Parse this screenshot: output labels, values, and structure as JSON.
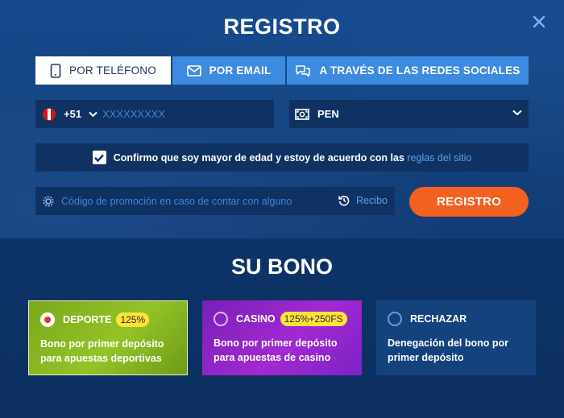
{
  "modal": {
    "title": "REGISTRO"
  },
  "tabs": [
    {
      "label": "POR TELÉFONO",
      "icon": "phone-icon",
      "active": true
    },
    {
      "label": "POR EMAIL",
      "icon": "envelope-icon",
      "active": false
    },
    {
      "label": "A TRAVÉS DE LAS REDES SOCIALES",
      "icon": "chat-bubbles-icon",
      "active": false
    }
  ],
  "phone": {
    "country_code": "+51",
    "placeholder": "XXXXXXXXX",
    "flag": "peru-flag-icon"
  },
  "currency": {
    "value": "PEN"
  },
  "confirm": {
    "text": "Confirmo que soy mayor de edad y estoy de acuerdo con las",
    "link": "reglas del sitio",
    "checked": true
  },
  "promo": {
    "placeholder": "Código de promoción en caso de contar con alguno",
    "recibo": "Recibo"
  },
  "submit": {
    "label": "REGISTRO"
  },
  "bonus": {
    "title": "SU BONO",
    "options": [
      {
        "name": "DEPORTE",
        "badge": "125%",
        "desc_1": "Bono por primer depósito",
        "desc_2": "para apuestas deportivas",
        "selected": true
      },
      {
        "name": "CASINO",
        "badge": "125%+250FS",
        "desc_1": "Bono por primer depósito",
        "desc_2": "para apuestas de casino",
        "selected": false
      },
      {
        "name": "RECHAZAR",
        "badge": "",
        "desc_1": "Denegación del bono por",
        "desc_2": "primer depósito",
        "selected": false
      }
    ]
  },
  "colors": {
    "accent": "#f2611e",
    "tab": "#3d8be0",
    "link": "#5aa0ea",
    "badge": "#ffe33a"
  }
}
